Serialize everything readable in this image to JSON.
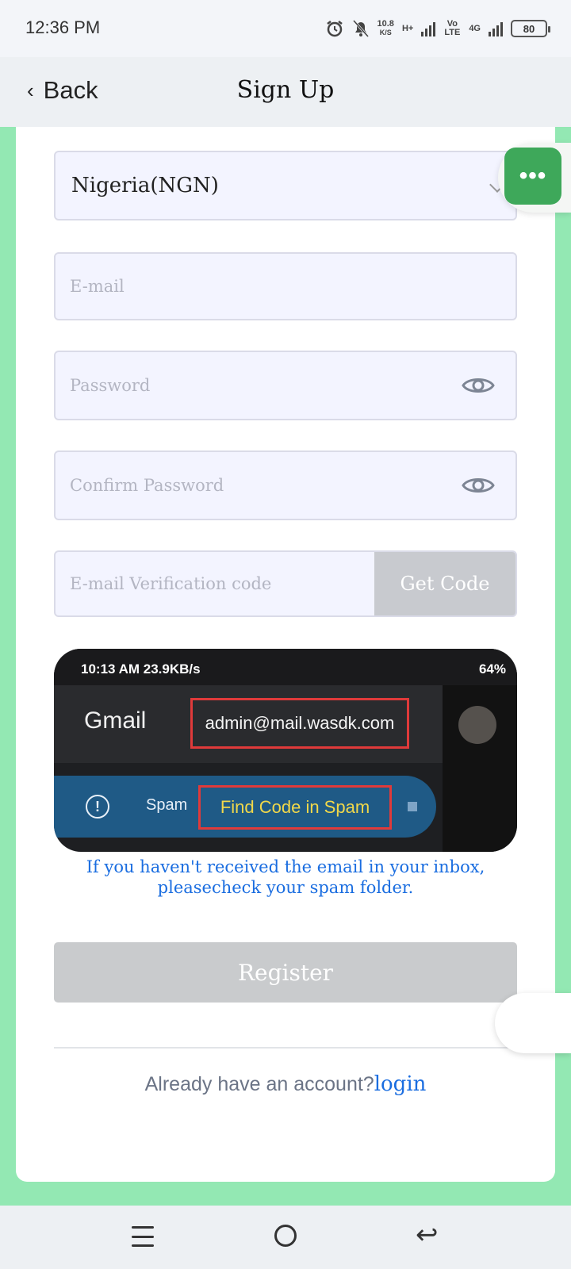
{
  "status_bar": {
    "time": "12:36 PM",
    "net_speed_value": "10.8",
    "net_speed_unit": "K/S",
    "network_1": "H+",
    "volte": "Vo LTE",
    "network_2": "4G",
    "battery": "80"
  },
  "header": {
    "back_label": "Back",
    "title": "Sign Up"
  },
  "form": {
    "country_select_value": "Nigeria(NGN)",
    "email_placeholder": "E-mail",
    "password_placeholder": "Password",
    "confirm_password_placeholder": "Confirm Password",
    "verification_placeholder": "E-mail Verification code",
    "get_code_label": "Get Code",
    "register_label": "Register"
  },
  "hint_image": {
    "status_left": "10:13 AM  23.9KB/s",
    "status_right": "64%",
    "gmail_label": "Gmail",
    "email_address": "admin@mail.wasdk.com",
    "spam_label": "Spam",
    "find_code_label": "Find Code in Spam"
  },
  "hint_text": "If you haven't received the email in your inbox, pleasecheck your spam folder.",
  "footer": {
    "already_text": "Already have an account?",
    "login_link": "login"
  },
  "colors": {
    "page_background": "#93e8b3",
    "link_blue": "#1a6de0",
    "chat_green": "#3ea85a",
    "disabled_gray": "#c9cbcd"
  },
  "icons": {
    "chat": "more-dots-icon",
    "password_toggle": "eye-icon",
    "nav_menu": "menu-icon",
    "nav_home": "home-icon",
    "nav_back": "back-icon"
  }
}
